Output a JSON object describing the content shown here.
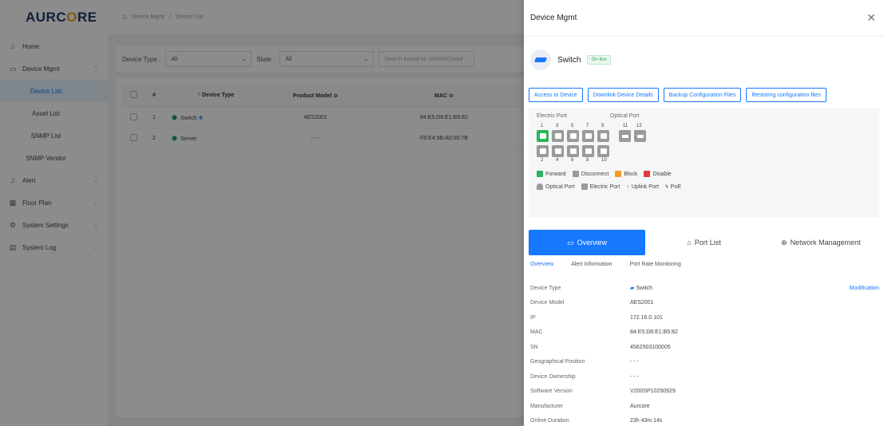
{
  "logo": {
    "prefix": "AURC",
    "o": "O",
    "suffix": "RE"
  },
  "sidebar": {
    "home": "Home",
    "device_mgmt": "Device Mgmt",
    "sub": [
      "Device List",
      "Asset List",
      "SNMP List",
      "SNMP Vendor"
    ],
    "alert": "Alert",
    "floor_plan": "Floor Plan",
    "system_settings": "System Settings",
    "system_log": "System Log"
  },
  "breadcrumb": [
    "Device Mgmt",
    "Device List"
  ],
  "filters": {
    "device_type_label": "Device Type :",
    "device_type_value": "All",
    "state_label": "State :",
    "state_value": "All",
    "search_placeholder": "Search based on SN/MAC/mod"
  },
  "table": {
    "headers": [
      "#",
      "Device Type",
      "Product Model ≎",
      "MAC ≎"
    ],
    "rows": [
      {
        "num": "1",
        "type": "Switch",
        "model": "AES2001",
        "mac": "84:E5:D8:E1:B5:82"
      },
      {
        "num": "2",
        "type": "Server",
        "model": "- - -",
        "mac": "F8:E4:3B:A0:00:7B"
      }
    ]
  },
  "drawer": {
    "title": "Device Mgmt",
    "device_name": "Switch",
    "status": "On-line",
    "buttons": [
      "Access to Device",
      "Downlink Device Details",
      "Backup Configuration Files",
      "Restoring configuration files"
    ],
    "electric_port_label": "Electric Port",
    "optical_port_label": "Optical Port",
    "top_nums": [
      "1",
      "3",
      "5",
      "7",
      "9"
    ],
    "optical_nums": [
      "11",
      "12"
    ],
    "bottom_nums": [
      "2",
      "4",
      "6",
      "8",
      "10"
    ],
    "legend1": [
      "Forward",
      "Disconnect",
      "Block",
      "Disable"
    ],
    "legend2": [
      "Optical Port",
      "Electric Port",
      "Uplink Port",
      "PoE"
    ],
    "main_tabs": [
      "Overview",
      "Port List",
      "Network Management"
    ],
    "sub_tabs": [
      "Overview",
      "Alert Information",
      "Port Rate Monitoring"
    ],
    "modification": "Modification",
    "info": [
      {
        "k": "Device Type",
        "v": "Switch"
      },
      {
        "k": "Device Model",
        "v": "AES2001"
      },
      {
        "k": "IP",
        "v": "172.16.0.101"
      },
      {
        "k": "MAC",
        "v": "84:E5:D8:E1:B5:82"
      },
      {
        "k": "SN",
        "v": "4562503100005"
      },
      {
        "k": "Geographical Position",
        "v": "- - -"
      },
      {
        "k": "Device Ownership",
        "v": "- - -"
      },
      {
        "k": "Software Version",
        "v": "V200SP10250929"
      },
      {
        "k": "Manufacturer",
        "v": "Aurcore"
      },
      {
        "k": "Online Duration",
        "v": "23h 43m 14s"
      }
    ]
  },
  "colors": {
    "accent": "#1677ff",
    "forward": "#2db55d",
    "disconnect": "#9a9a9a",
    "block": "#f59a23",
    "disable": "#e03c3c"
  }
}
